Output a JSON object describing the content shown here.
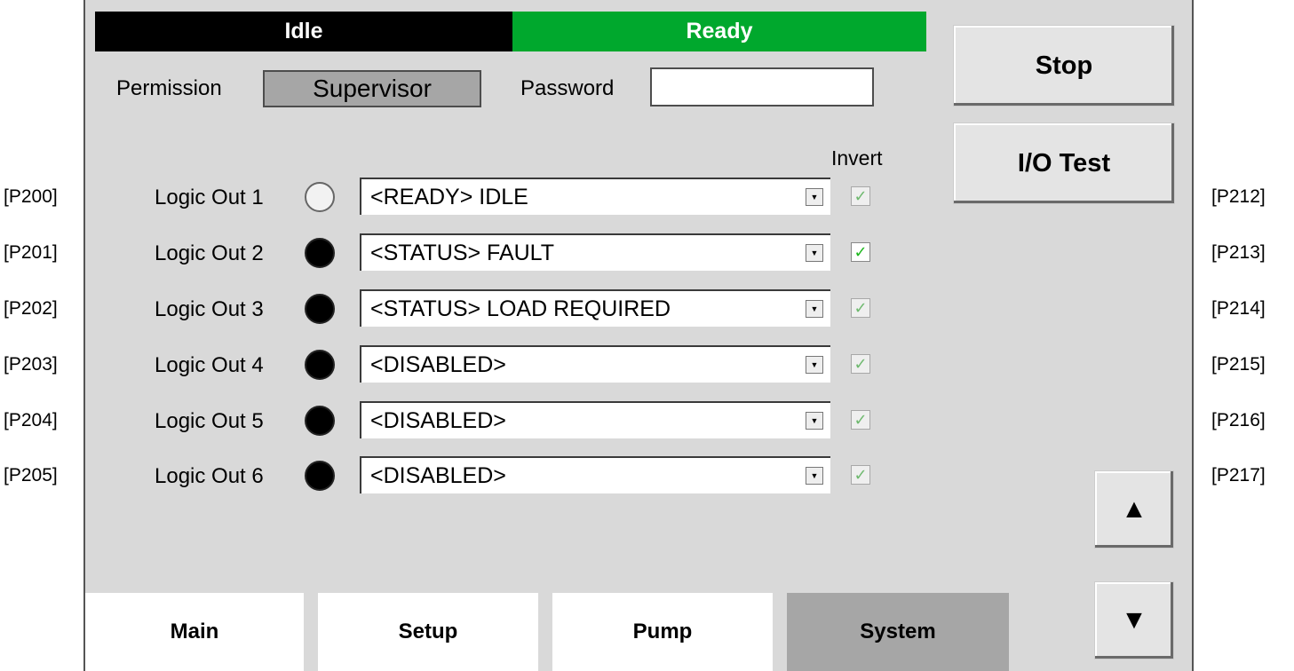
{
  "status": {
    "left": "Idle",
    "right": "Ready",
    "right_color": "#00a82d"
  },
  "permission": {
    "label": "Permission",
    "value": "Supervisor"
  },
  "password": {
    "label": "Password",
    "value": ""
  },
  "buttons": {
    "stop": "Stop",
    "io_test": "I/O Test",
    "up": "▲",
    "down": "▼"
  },
  "invert_header": "Invert",
  "rows": [
    {
      "param_left": "[P200]",
      "label": "Logic Out 1",
      "value": "<READY> IDLE",
      "param_right": "[P212]"
    },
    {
      "param_left": "[P201]",
      "label": "Logic Out 2",
      "value": "<STATUS> FAULT",
      "param_right": "[P213]"
    },
    {
      "param_left": "[P202]",
      "label": "Logic Out 3",
      "value": "<STATUS> LOAD REQUIRED",
      "param_right": "[P214]"
    },
    {
      "param_left": "[P203]",
      "label": "Logic Out 4",
      "value": "<DISABLED>",
      "param_right": "[P215]"
    },
    {
      "param_left": "[P204]",
      "label": "Logic Out 5",
      "value": "<DISABLED>",
      "param_right": "[P216]"
    },
    {
      "param_left": "[P205]",
      "label": "Logic Out 6",
      "value": "<DISABLED>",
      "param_right": "[P217]"
    }
  ],
  "tabs": [
    "Main",
    "Setup",
    "Pump",
    "System"
  ]
}
